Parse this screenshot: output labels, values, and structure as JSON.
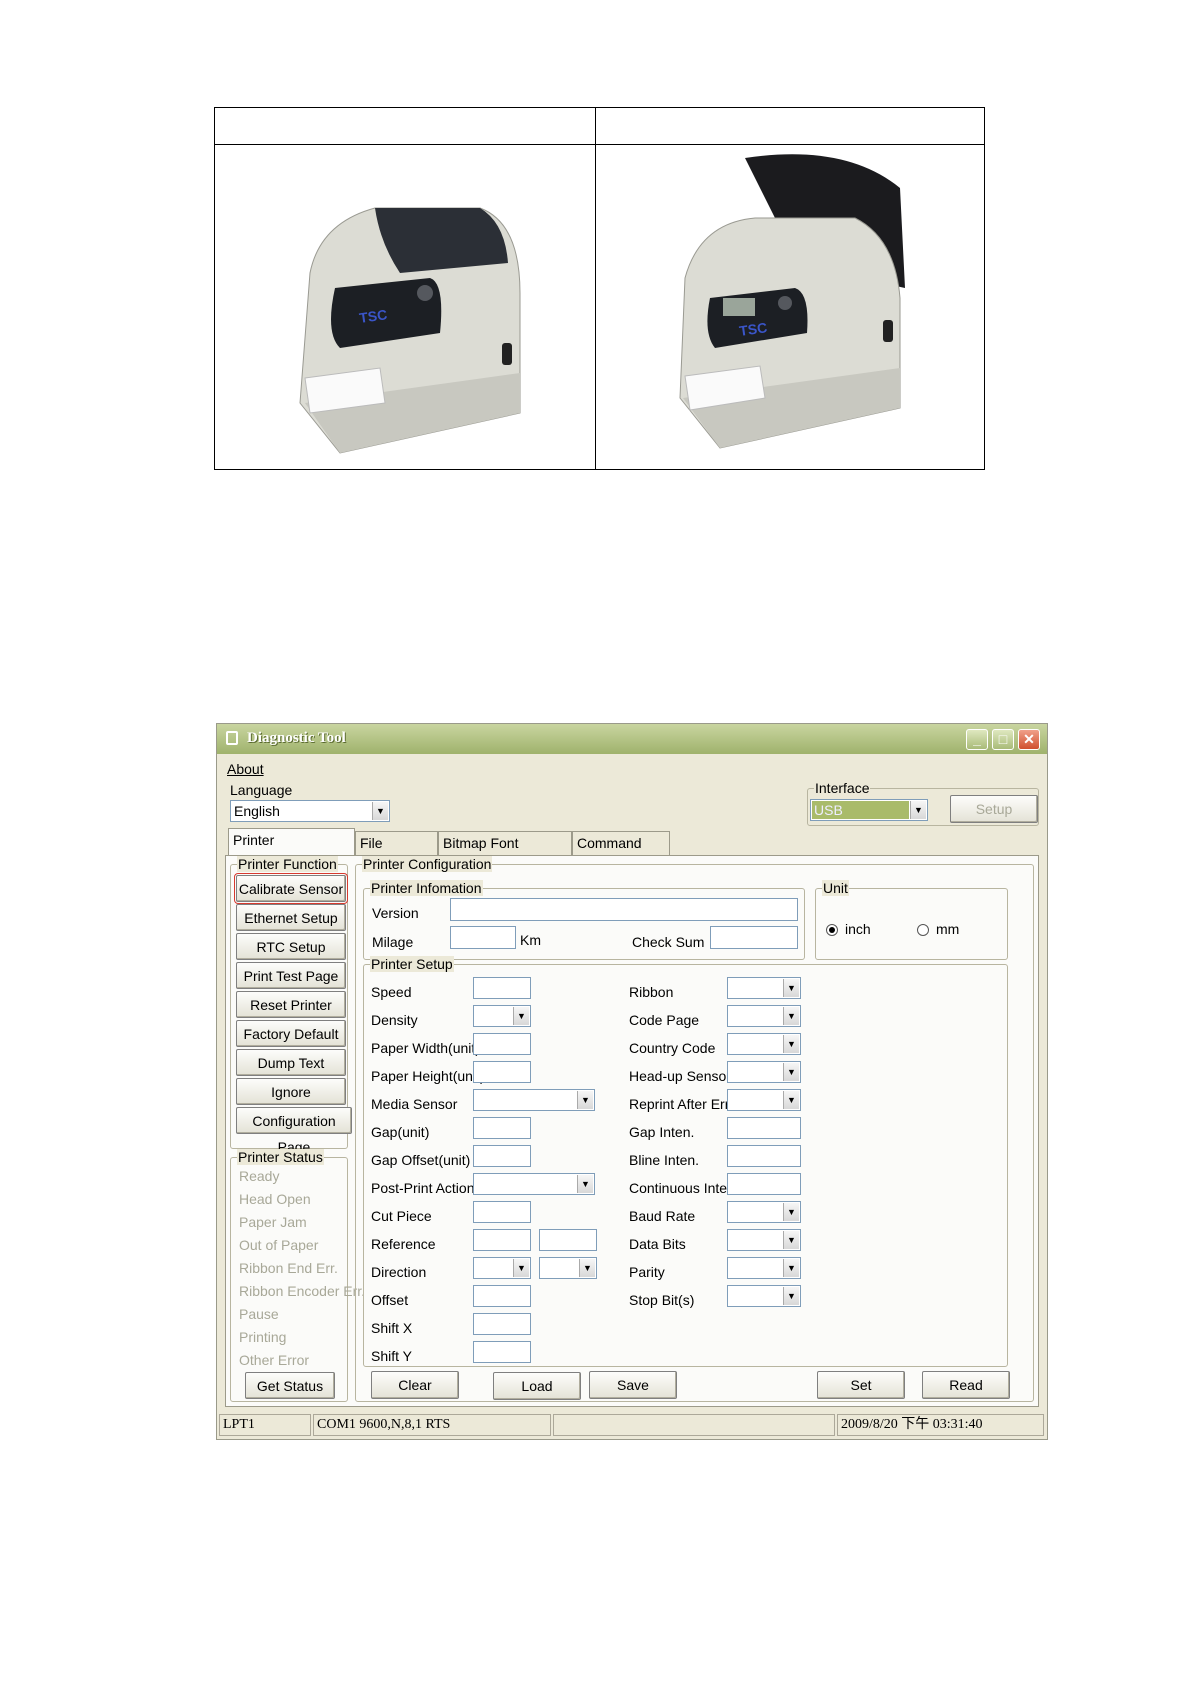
{
  "window": {
    "title": "Diagnostic Tool",
    "menu_about": "About",
    "language_label": "Language",
    "language_value": "English",
    "interface_label": "Interface",
    "interface_value": "USB",
    "setup_button": "Setup",
    "tabs": [
      "Printer Configuration",
      "File Manager",
      "Bitmap Font Manager",
      "Command Tool"
    ],
    "printer_function": {
      "label": "Printer Function",
      "buttons": [
        "Calibrate Sensor",
        "Ethernet Setup",
        "RTC Setup",
        "Print Test Page",
        "Reset Printer",
        "Factory Default",
        "Dump Text",
        "Ignore AUTO.BAS",
        "Configuration Page"
      ]
    },
    "printer_status": {
      "label": "Printer Status",
      "items": [
        "Ready",
        "Head Open",
        "Paper Jam",
        "Out of Paper",
        "Ribbon End Err.",
        "Ribbon Encoder Err.",
        "Pause",
        "Printing",
        "Other Error"
      ],
      "get_status": "Get Status"
    },
    "printer_configuration": {
      "label": "Printer Configuration",
      "info_label": "Printer Infomation",
      "version": "Version",
      "milage": "Milage",
      "km": "Km",
      "check_sum": "Check Sum",
      "unit_label": "Unit",
      "unit_inch": "inch",
      "unit_mm": "mm",
      "setup_label": "Printer Setup",
      "left_fields": [
        "Speed",
        "Density",
        "Paper Width(unit)",
        "Paper Height(unit)",
        "Media Sensor",
        "Gap(unit)",
        "Gap Offset(unit)",
        "Post-Print Action",
        "Cut Piece",
        "Reference",
        "Direction",
        "Offset",
        "Shift X",
        "Shift Y"
      ],
      "right_fields": [
        "Ribbon",
        "Code Page",
        "Country Code",
        "Head-up Sensor",
        "Reprint After Error",
        "Gap Inten.",
        "Bline Inten.",
        "Continuous Inten.",
        "Baud Rate",
        "Data Bits",
        "Parity",
        "Stop Bit(s)"
      ]
    },
    "bottom_buttons": [
      "Clear",
      "Load",
      "Save",
      "Set",
      "Read"
    ],
    "status_bar": [
      "LPT1",
      "COM1 9600,N,8,1 RTS",
      "",
      "2009/8/20 下午 03:31:40"
    ]
  }
}
